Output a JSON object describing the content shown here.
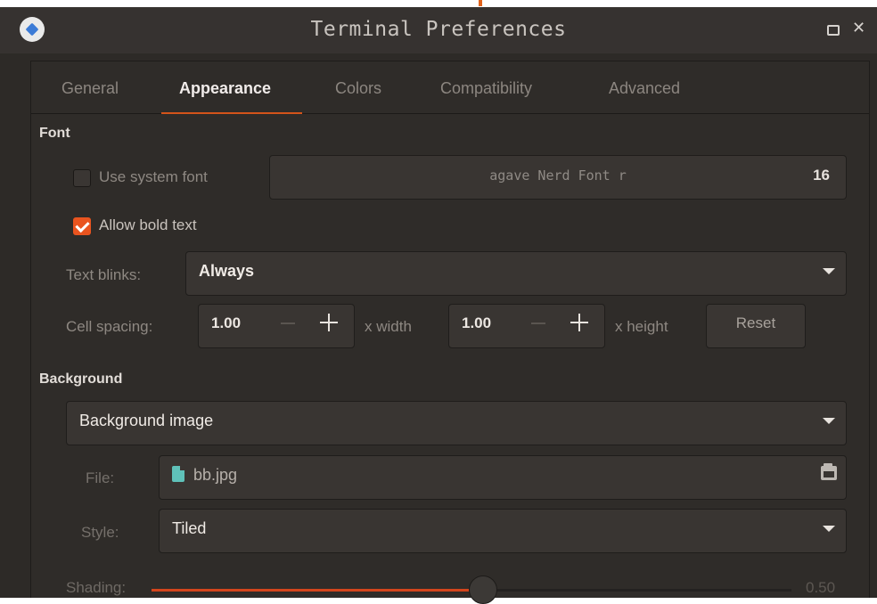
{
  "window": {
    "title": "Terminal Preferences"
  },
  "tabs": [
    {
      "label": "General",
      "active": false
    },
    {
      "label": "Appearance",
      "active": true
    },
    {
      "label": "Colors",
      "active": false
    },
    {
      "label": "Compatibility",
      "active": false
    },
    {
      "label": "Advanced",
      "active": false
    }
  ],
  "font_section": {
    "heading": "Font",
    "use_system_font": {
      "label": "Use system font",
      "checked": false
    },
    "font_button": {
      "name": "agave Nerd Font r",
      "size": "16"
    },
    "allow_bold": {
      "label": "Allow bold text",
      "checked": true
    },
    "text_blinks": {
      "label": "Text blinks:",
      "value": "Always"
    },
    "cell_spacing": {
      "label": "Cell spacing:",
      "width_value": "1.00",
      "width_suffix": "x width",
      "height_value": "1.00",
      "height_suffix": "x height",
      "reset_label": "Reset"
    }
  },
  "background_section": {
    "heading": "Background",
    "mode": "Background image",
    "file": {
      "label": "File:",
      "value": "bb.jpg"
    },
    "style": {
      "label": "Style:",
      "value": "Tiled"
    },
    "shading": {
      "label": "Shading:",
      "value": 0.5,
      "value_text": "0.50"
    }
  },
  "colors": {
    "accent": "#e9541f",
    "background": "#2d2a27",
    "titlebar": "#363230"
  },
  "icons": {
    "app": "terminal-app-icon",
    "maximize": "maximize-icon",
    "close": "close-icon",
    "file": "image-file-icon",
    "open": "open-folder-icon",
    "dropdown": "chevron-down-icon"
  }
}
